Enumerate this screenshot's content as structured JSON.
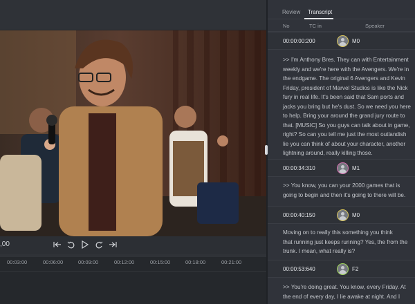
{
  "player": {
    "timecode": ",00",
    "timeline_ticks": [
      "00:03:00",
      "00:06:00",
      "00:09:00",
      "00:12:00",
      "00:15:00",
      "00:18:00",
      "00:21:00"
    ]
  },
  "controls_icons": [
    "skip-start-icon",
    "rewind-icon",
    "play-icon",
    "forward-icon",
    "skip-end-icon"
  ],
  "panel": {
    "tabs": [
      {
        "label": "Review",
        "active": false
      },
      {
        "label": "Transcript",
        "active": true
      }
    ],
    "columns": {
      "no": "No",
      "tc_in": "TC in",
      "speaker": "Speaker"
    }
  },
  "entries": [
    {
      "tc": "00:00:00:200",
      "speaker": "M0",
      "ring_color": "#d6c35a",
      "text": ">> I'm Anthony Bres. They can with Entertainment\nweekly and we're here with the Avengers. We're in\nthe endgame. The original 6 Avengers and Kevin\nFriday, president of Marvel Studios is like the Nick\nfury in real life. It's been said that Sam ports and\njacks you bring but he's dust. So we need you here\nto help. Bring your around the grand jury route to\nthat. [MUSIC] So you guys can talk about in game,\nright? So can you tell me just the most outlandish\nlie you can think of about your character, another\nlightning around, really killing those."
    },
    {
      "tc": "00:00:34:310",
      "speaker": "M1",
      "ring_color": "#d46fb0",
      "text": ">> You know, you can your 2000 games that is\ngoing to begin and then it's going to there will be."
    },
    {
      "tc": "00:00:40:150",
      "speaker": "M0",
      "ring_color": "#d6c35a",
      "text": "Moving on to really this something you think\nthat running just keeps running? Yes, the from the\ntrunk. I mean, what really is?"
    },
    {
      "tc": "00:00:53:640",
      "speaker": "F2",
      "ring_color": "#9fd45a",
      "text": ">> You're doing great. You know, every Friday. At\nthe end of every day, I lie awake at night. And I"
    }
  ]
}
